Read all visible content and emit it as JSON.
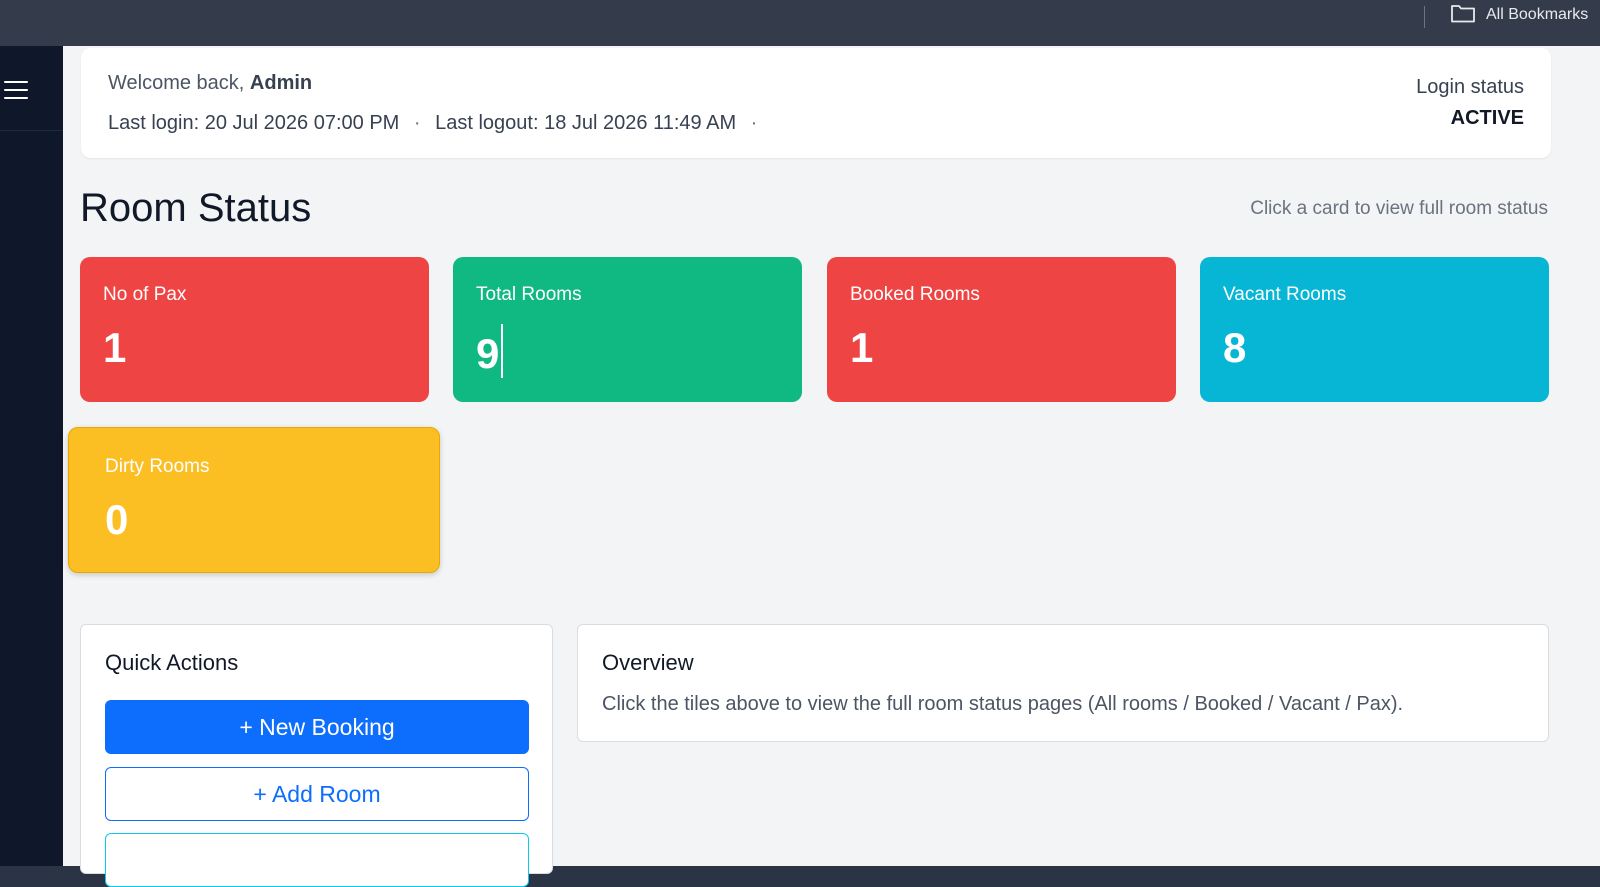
{
  "bookmarks": {
    "all_bookmarks": "All Bookmarks"
  },
  "welcome": {
    "greeting": "Welcome back,",
    "user": "Admin",
    "last_login_label": "Last login:",
    "last_login": "20 Jul 2026 07:00 PM",
    "last_logout_label": "Last logout:",
    "last_logout": "18 Jul 2026 11:49 AM",
    "separator": "·",
    "status_label": "Login status",
    "status_value": "ACTIVE"
  },
  "room_status": {
    "title": "Room Status",
    "hint": "Click a card to view full room status",
    "cards": [
      {
        "label": "No of Pax",
        "value": "1",
        "color": "#ef4444"
      },
      {
        "label": "Total Rooms",
        "value": "9",
        "color": "#10b981"
      },
      {
        "label": "Booked Rooms",
        "value": "1",
        "color": "#ef4444"
      },
      {
        "label": "Vacant Rooms",
        "value": "8",
        "color": "#06b6d4"
      },
      {
        "label": "Dirty Rooms",
        "value": "0",
        "color": "#fbbf24"
      }
    ]
  },
  "quick_actions": {
    "title": "Quick Actions",
    "new_booking": "+ New Booking",
    "add_room": "+ Add Room"
  },
  "overview": {
    "title": "Overview",
    "text": "Click the tiles above to view the full room status pages (All rooms / Booked / Vacant / Pax)."
  }
}
